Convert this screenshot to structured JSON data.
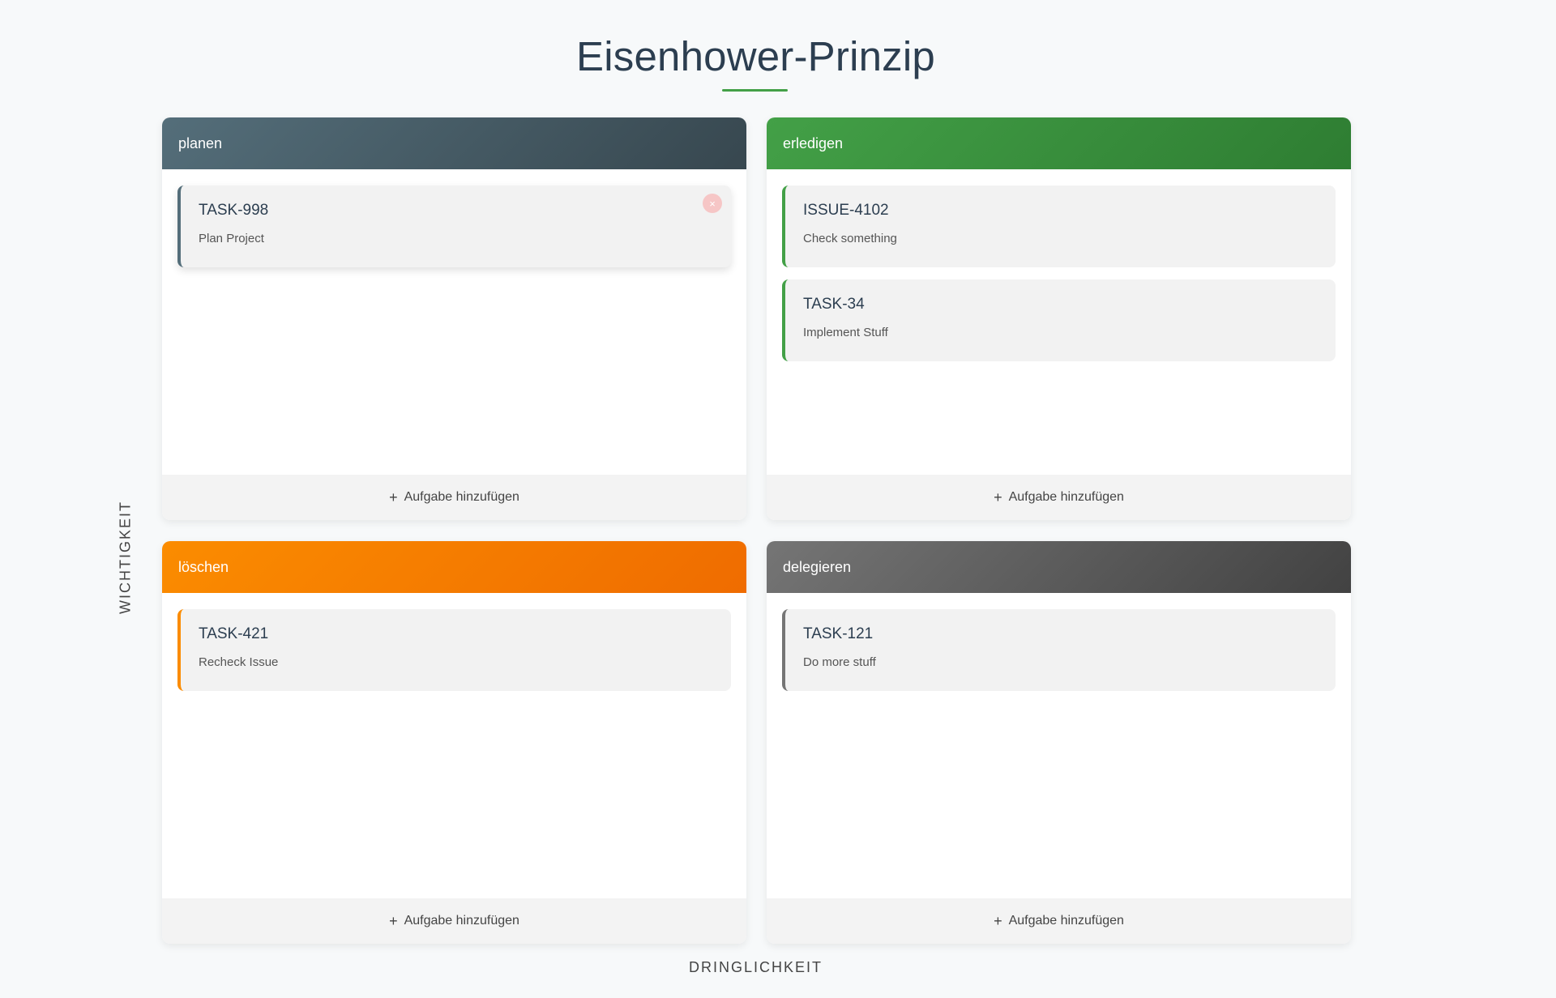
{
  "title": "Eisenhower-Prinzip",
  "axis": {
    "y_label": "WICHTIGKEIT",
    "x_label": "DRINGLICHKEIT"
  },
  "add_label": "Aufgabe hinzufügen",
  "add_icon": "+",
  "delete_icon": "×",
  "colors": {
    "accent": "#43a047",
    "planen": "#546e7a",
    "erledigen": "#43a047",
    "loeschen": "#fb8c00",
    "delegieren": "#757575"
  },
  "quadrants": [
    {
      "key": "planen",
      "label": "planen",
      "tasks": [
        {
          "id": "TASK-998",
          "title": "Plan Project"
        }
      ]
    },
    {
      "key": "erledigen",
      "label": "erledigen",
      "tasks": [
        {
          "id": "ISSUE-4102",
          "title": "Check something"
        },
        {
          "id": "TASK-34",
          "title": "Implement Stuff"
        }
      ]
    },
    {
      "key": "loeschen",
      "label": "löschen",
      "tasks": [
        {
          "id": "TASK-421",
          "title": "Recheck Issue"
        }
      ]
    },
    {
      "key": "delegieren",
      "label": "delegieren",
      "tasks": [
        {
          "id": "TASK-121",
          "title": "Do more stuff"
        }
      ]
    }
  ]
}
